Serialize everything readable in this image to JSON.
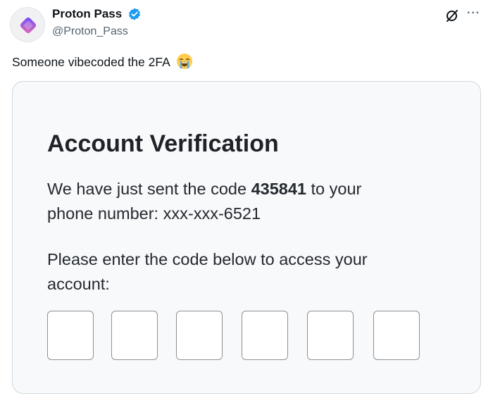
{
  "author": {
    "name": "Proton Pass",
    "handle": "@Proton_Pass",
    "verified": true,
    "avatar_icon": "proton-pass-logo-icon"
  },
  "header_actions": {
    "grok_icon": "grok-icon",
    "more_label": "···"
  },
  "tweet": {
    "text": "Someone vibecoded the 2FA",
    "emoji": "loudly-crying-face-icon"
  },
  "media": {
    "title": "Account Verification",
    "sent_prefix": "We have just sent the code ",
    "code": "435841",
    "sent_suffix": " to your",
    "phone_line": "phone number: xxx-xxx-6521",
    "prompt_line1": "Please enter the code below to access your",
    "prompt_line2": "account:",
    "code_boxes": [
      "",
      "",
      "",
      "",
      "",
      ""
    ]
  },
  "colors": {
    "verified_blue": "#1d9bf0",
    "logo_gradient_start": "#6d4aff",
    "logo_gradient_end": "#e56bb0"
  }
}
